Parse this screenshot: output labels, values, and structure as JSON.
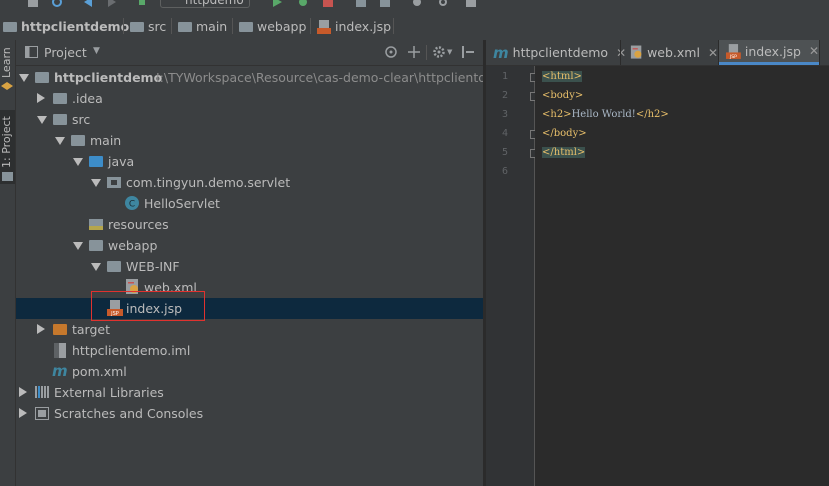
{
  "toolbar": {
    "run_config_label": "httpdemo"
  },
  "navbar": {
    "crumbs": [
      "httpclientdemo",
      "src",
      "main",
      "webapp",
      "index.jsp"
    ]
  },
  "left_strip": {
    "learn_label": "Learn",
    "project_label": "1: Project"
  },
  "project_panel": {
    "title": "Project",
    "tree": [
      {
        "label": "httpclientdemo",
        "path": "I:\\TYWorkspace\\Resource\\cas-demo-clear\\httpclientdem"
      },
      {
        "label": ".idea"
      },
      {
        "label": "src"
      },
      {
        "label": "main"
      },
      {
        "label": "java"
      },
      {
        "label": "com.tingyun.demo.servlet"
      },
      {
        "label": "HelloServlet"
      },
      {
        "label": "resources"
      },
      {
        "label": "webapp"
      },
      {
        "label": "WEB-INF"
      },
      {
        "label": "web.xml"
      },
      {
        "label": "index.jsp"
      },
      {
        "label": "target"
      },
      {
        "label": "httpclientdemo.iml"
      },
      {
        "label": "pom.xml"
      },
      {
        "label": "External Libraries"
      },
      {
        "label": "Scratches and Consoles"
      }
    ]
  },
  "editor": {
    "tabs": [
      {
        "label": "httpclientdemo"
      },
      {
        "label": "web.xml"
      },
      {
        "label": "index.jsp",
        "active": true
      }
    ],
    "line_numbers": [
      "1",
      "2",
      "3",
      "4",
      "5",
      "6"
    ],
    "lines": [
      {
        "open": "<html>"
      },
      {
        "open": "<body>"
      },
      {
        "open": "<h2>",
        "text": "Hello World!",
        "close": "</h2>"
      },
      {
        "open": "</body>"
      },
      {
        "open": "</html>"
      },
      {
        "open": ""
      }
    ]
  },
  "colors": {
    "panel_bg": "#3c3f41",
    "editor_bg": "#2b2b2b",
    "selection": "#0d293e",
    "tag": "#e8bf6a",
    "highlight_box": "#e0322f",
    "active_tab_underline": "#4a88c7"
  }
}
